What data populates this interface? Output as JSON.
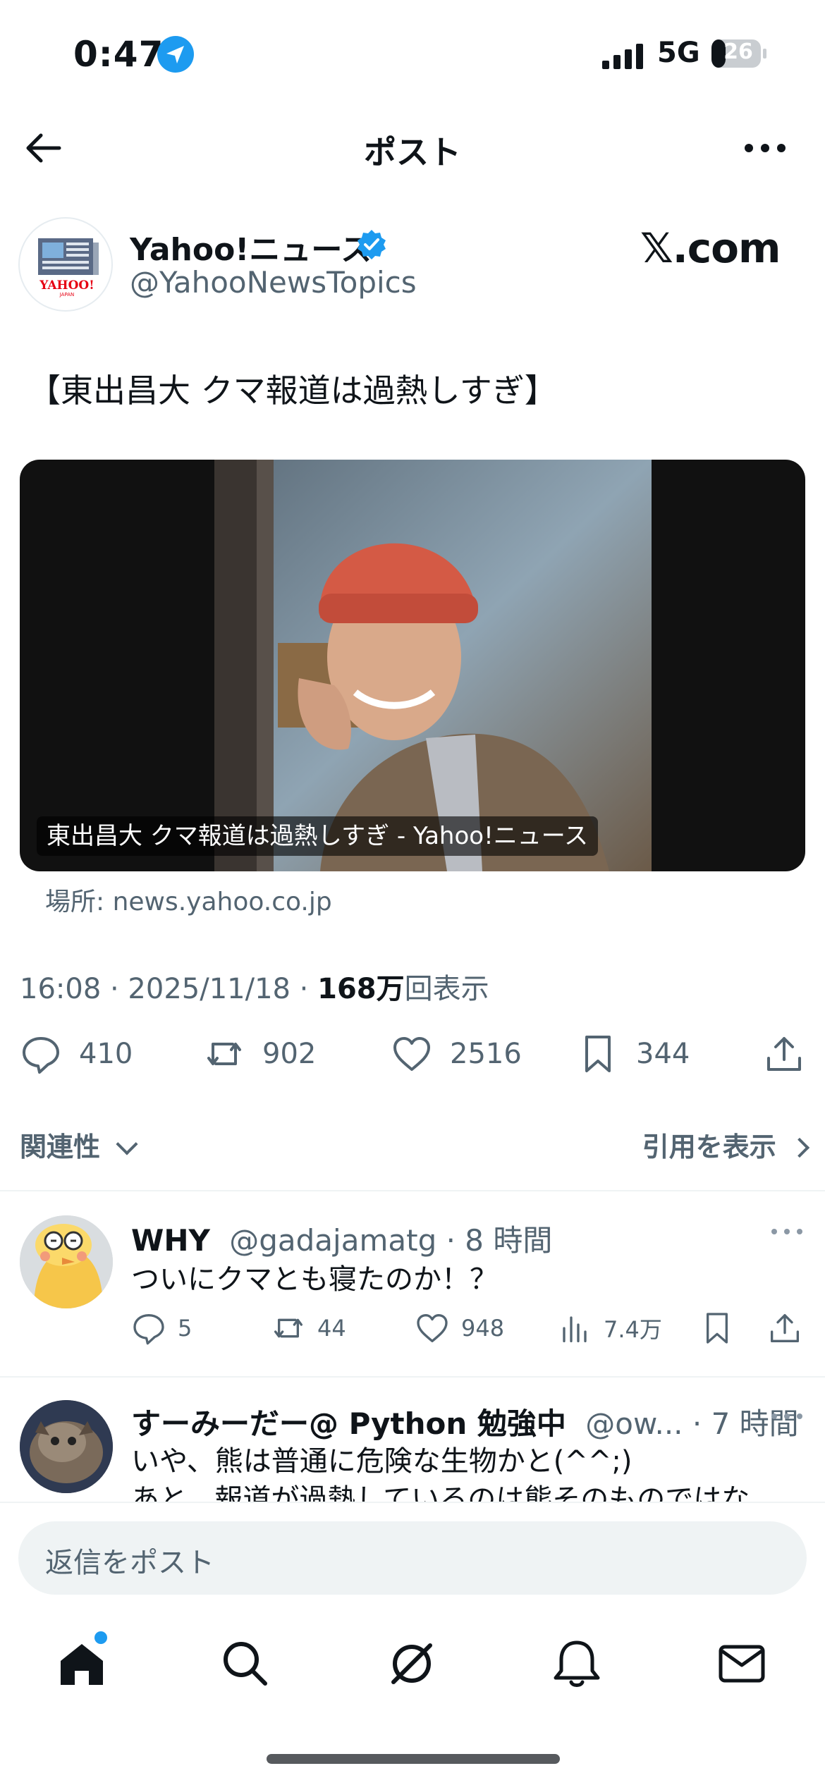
{
  "status_bar": {
    "time": "0:47",
    "network": "5G",
    "battery": "26"
  },
  "header": {
    "title": "ポスト"
  },
  "post": {
    "author_name": "Yahoo!ニュース",
    "author_handle": "@YahooNewsTopics",
    "avatar_label": "YAHOO!",
    "avatar_sublabel": "JAPAN",
    "source_logo": "𝕏.com",
    "text": "【東出昌大 クマ報道は過熱しすぎ】",
    "media_caption": "東出昌大 クマ報道は過熱しすぎ - Yahoo!ニュース",
    "media_source": "場所: news.yahoo.co.jp",
    "meta_time": "16:08 · 2025/11/18 · ",
    "meta_views": "168万",
    "meta_views_suffix": "回表示",
    "stats": {
      "replies": "410",
      "reposts": "902",
      "likes": "2516",
      "bookmarks": "344"
    },
    "related_label": "関連性",
    "quotes_label": "引用を表示"
  },
  "replies": [
    {
      "name": "WHY",
      "handle": "@gadajamatg",
      "time": "· 8 時間",
      "lines": [
        "ついにクマとも寝たのか！？"
      ],
      "stats": {
        "replies": "5",
        "reposts": "44",
        "likes": "948",
        "views": "7.4万"
      }
    },
    {
      "name": "すーみーだー@ Python 勉強中",
      "handle": "@ow...",
      "time": "· 7 時間",
      "lines": [
        "いや、熊は普通に危険な生物かと(^^;)",
        "あと、報道が過熱しているのは熊そのものではな"
      ]
    }
  ],
  "composer": {
    "placeholder": "返信をポスト"
  },
  "colors": {
    "accent": "#1d9bf0",
    "text": "#0f1419",
    "muted": "#536471"
  }
}
